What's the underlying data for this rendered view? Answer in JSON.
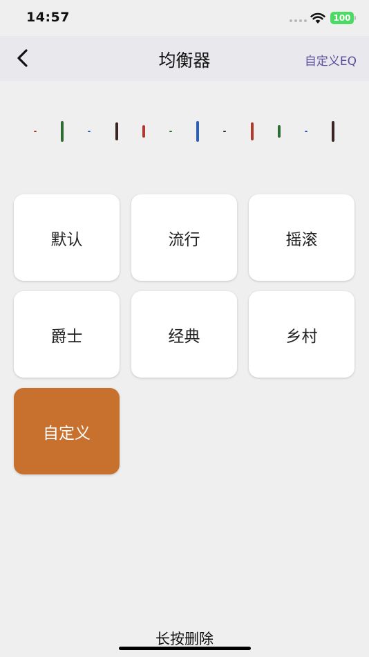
{
  "status_bar": {
    "time": "14:57",
    "battery": "100"
  },
  "nav": {
    "title": "均衡器",
    "right_action": "自定义EQ",
    "back_icon": "chevron-left-icon"
  },
  "eq_bands": [
    {
      "level": 0.05,
      "color": "#b03a2e"
    },
    {
      "level": 0.55,
      "color": "#2e6b34"
    },
    {
      "level": 0.05,
      "color": "#2f5fb0"
    },
    {
      "level": 0.47,
      "color": "#3a2424"
    },
    {
      "level": 0.34,
      "color": "#b03a2e"
    },
    {
      "level": 0.05,
      "color": "#2e6b34"
    },
    {
      "level": 0.55,
      "color": "#2f5fb0"
    },
    {
      "level": 0.05,
      "color": "#3a2424"
    },
    {
      "level": 0.47,
      "color": "#b03a2e"
    },
    {
      "level": 0.34,
      "color": "#2e6b34"
    },
    {
      "level": 0.05,
      "color": "#2f5fb0"
    },
    {
      "level": 0.55,
      "color": "#3a2424"
    }
  ],
  "presets": [
    {
      "label": "默认",
      "active": false
    },
    {
      "label": "流行",
      "active": false
    },
    {
      "label": "摇滚",
      "active": false
    },
    {
      "label": "爵士",
      "active": false
    },
    {
      "label": "经典",
      "active": false
    },
    {
      "label": "乡村",
      "active": false
    },
    {
      "label": "自定义",
      "active": true
    }
  ],
  "colors": {
    "accent": "#c8702e",
    "link": "#5b4e9e"
  },
  "footer": {
    "hint": "长按删除"
  }
}
